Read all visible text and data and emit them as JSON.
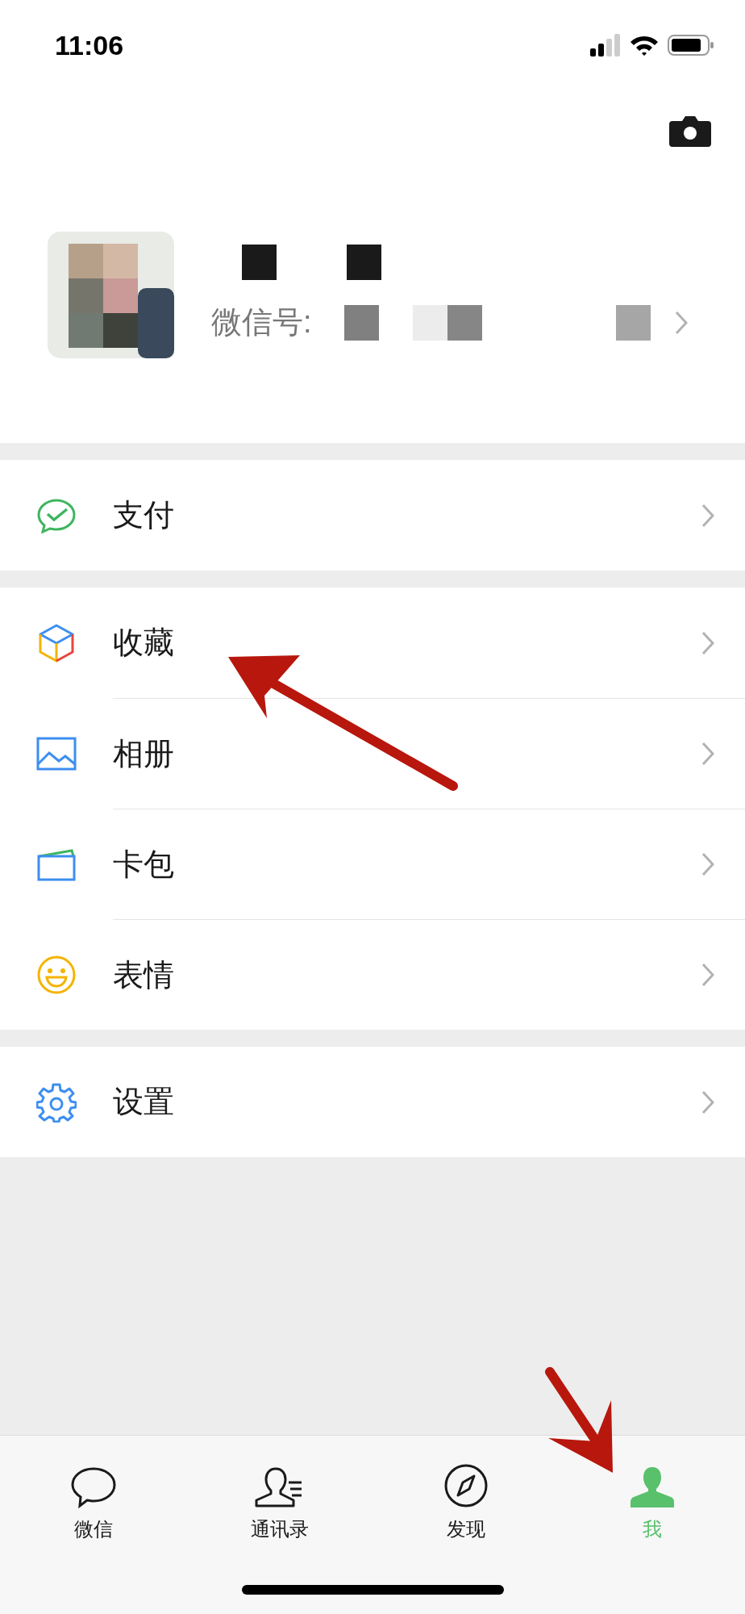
{
  "status_bar": {
    "time": "11:06"
  },
  "profile": {
    "wechat_id_label": "微信号:"
  },
  "groups": [
    [
      {
        "kind": "pay",
        "label": "支付"
      }
    ],
    [
      {
        "kind": "favorites",
        "label": "收藏"
      },
      {
        "kind": "album",
        "label": "相册"
      },
      {
        "kind": "cards",
        "label": "卡包"
      },
      {
        "kind": "stickers",
        "label": "表情"
      }
    ],
    [
      {
        "kind": "settings",
        "label": "设置"
      }
    ]
  ],
  "tabs": [
    {
      "kind": "chat",
      "label": "微信",
      "selected": false
    },
    {
      "kind": "contacts",
      "label": "通讯录",
      "selected": false
    },
    {
      "kind": "discover",
      "label": "发现",
      "selected": false
    },
    {
      "kind": "me",
      "label": "我",
      "selected": true
    }
  ]
}
